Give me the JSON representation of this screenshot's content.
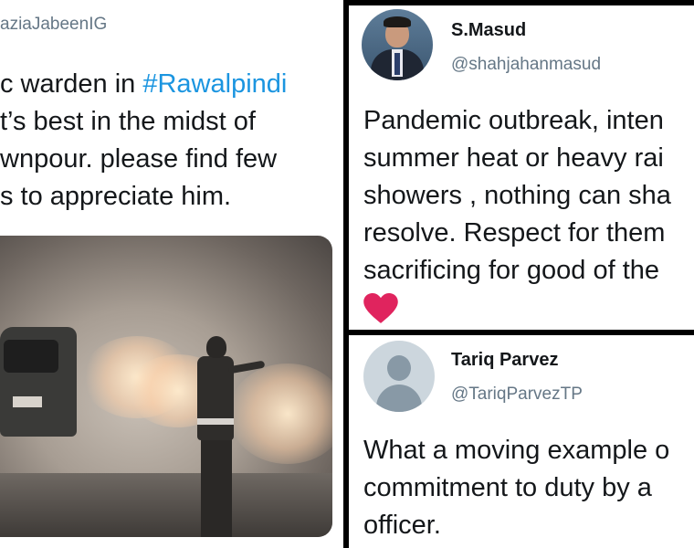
{
  "left_tweet": {
    "handle": "aziaJabeenIG",
    "lines": [
      {
        "pre": "c warden in ",
        "hashtag": "#Rawalpindi"
      },
      {
        "text": "t’s best in the midst of"
      },
      {
        "text": "wnpour. please find few"
      },
      {
        "text": "s to appreciate him."
      }
    ]
  },
  "tweet_masud": {
    "name": "S.Masud",
    "handle": "@shahjahanmasud",
    "lines": [
      "Pandemic outbreak, inten",
      "summer heat or heavy rai",
      "showers , nothing can sha",
      "resolve. Respect for them",
      "sacrificing for good of the"
    ],
    "emoji": "heart"
  },
  "tweet_tariq": {
    "name": "Tariq Parvez",
    "handle": "@TariqParvezTP",
    "lines": [
      "What a moving example o",
      "commitment to duty by a",
      "officer."
    ]
  },
  "colors": {
    "hashtag": "#1b95e0",
    "text": "#14171a",
    "secondary": "#657786",
    "heart": "#e0245e",
    "divider": "#000000"
  }
}
